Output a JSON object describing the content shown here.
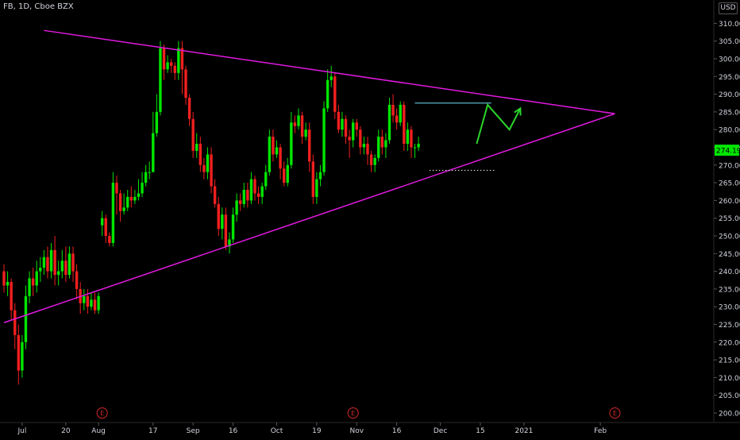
{
  "header": {
    "symbol": "FB, 1D, Cboe BZX",
    "currency": "USD"
  },
  "price_tag": "274.19",
  "colors": {
    "up": "#00e600",
    "down": "#f0201e",
    "trendline": "#e01adf",
    "projection": "#2bd52b",
    "resistance": "#5bb6c9",
    "support": "#cfcfcf",
    "axis_text": "#d1d4dc",
    "earnings": "#d12929",
    "price_tag_bg": "#00e600"
  },
  "chart_data": {
    "type": "candlestick",
    "y_axis": {
      "min": 197.5,
      "max": 317.5,
      "ticks": [
        "200.00",
        "205.00",
        "210.00",
        "215.00",
        "220.00",
        "225.00",
        "230.00",
        "235.00",
        "240.00",
        "245.00",
        "250.00",
        "255.00",
        "260.00",
        "265.00",
        "270.00",
        "275.00",
        "280.00",
        "285.00",
        "290.00",
        "295.00",
        "300.00",
        "305.00",
        "310.00"
      ]
    },
    "x_axis": {
      "labels": [
        {
          "label": "Jul",
          "session": 5
        },
        {
          "label": "20",
          "session": 17
        },
        {
          "label": "Aug",
          "session": 26
        },
        {
          "label": "17",
          "session": 41
        },
        {
          "label": "Sep",
          "session": 52
        },
        {
          "label": "16",
          "session": 63
        },
        {
          "label": "Oct",
          "session": 75
        },
        {
          "label": "19",
          "session": 86
        },
        {
          "label": "Nov",
          "session": 97
        },
        {
          "label": "16",
          "session": 108
        },
        {
          "label": "Dec",
          "session": 120
        },
        {
          "label": "15",
          "session": 131
        },
        {
          "label": "2021",
          "session": 143
        },
        {
          "label": "Feb",
          "session": 164
        }
      ]
    },
    "earnings_markers": [
      {
        "label": "E",
        "session": 27
      },
      {
        "label": "E",
        "session": 96
      },
      {
        "label": "E",
        "session": 168
      }
    ],
    "candles": [
      [
        240,
        236,
        242,
        234
      ],
      [
        236,
        237,
        240,
        233
      ],
      [
        237,
        229,
        238,
        226
      ],
      [
        229,
        222,
        231,
        218
      ],
      [
        222,
        212,
        225,
        208
      ],
      [
        212,
        220,
        222,
        210
      ],
      [
        220,
        233,
        236,
        218
      ],
      [
        233,
        238,
        240,
        231
      ],
      [
        238,
        236,
        241,
        233
      ],
      [
        236,
        240,
        243,
        234
      ],
      [
        240,
        241,
        244,
        237
      ],
      [
        241,
        244,
        246,
        239
      ],
      [
        244,
        240,
        247,
        238
      ],
      [
        240,
        246,
        248,
        238
      ],
      [
        246,
        239,
        250,
        236
      ],
      [
        239,
        240,
        243,
        236
      ],
      [
        240,
        243,
        246,
        238
      ],
      [
        243,
        239,
        247,
        237
      ],
      [
        239,
        245,
        247,
        238
      ],
      [
        245,
        240,
        247,
        237
      ],
      [
        240,
        235,
        242,
        232
      ],
      [
        235,
        231,
        237,
        228
      ],
      [
        231,
        233,
        235,
        229
      ],
      [
        233,
        230,
        235,
        228
      ],
      [
        230,
        232,
        234,
        229
      ],
      [
        232,
        229,
        234,
        228
      ],
      [
        229,
        233,
        234,
        228
      ],
      [
        253,
        255,
        257,
        250
      ],
      [
        255,
        250,
        256,
        248
      ],
      [
        250,
        248,
        251,
        247
      ],
      [
        248,
        265,
        268,
        247
      ],
      [
        265,
        262,
        267,
        256
      ],
      [
        262,
        257,
        263,
        254
      ],
      [
        257,
        258,
        262,
        256
      ],
      [
        258,
        261,
        263,
        257
      ],
      [
        261,
        260,
        264,
        258
      ],
      [
        260,
        261,
        263,
        259
      ],
      [
        261,
        262,
        266,
        260
      ],
      [
        262,
        265,
        268,
        261
      ],
      [
        265,
        268,
        270,
        264
      ],
      [
        268,
        268,
        271,
        266
      ],
      [
        268,
        279,
        285,
        268
      ],
      [
        279,
        285,
        290,
        278
      ],
      [
        285,
        303,
        305,
        284
      ],
      [
        303,
        297,
        304,
        294
      ],
      [
        297,
        299,
        301,
        296
      ],
      [
        299,
        298,
        300,
        296
      ],
      [
        298,
        296,
        299,
        294
      ],
      [
        296,
        303,
        305,
        294
      ],
      [
        303,
        297,
        305,
        290
      ],
      [
        297,
        289,
        298,
        287
      ],
      [
        289,
        283,
        290,
        281
      ],
      [
        283,
        274,
        285,
        272
      ],
      [
        274,
        276,
        279,
        272
      ],
      [
        276,
        270,
        278,
        268
      ],
      [
        270,
        268,
        272,
        266
      ],
      [
        268,
        273,
        275,
        266
      ],
      [
        273,
        264,
        275,
        262
      ],
      [
        264,
        259,
        266,
        258
      ],
      [
        259,
        252,
        261,
        250
      ],
      [
        252,
        256,
        258,
        249
      ],
      [
        256,
        247,
        258,
        246
      ],
      [
        247,
        249,
        251,
        245
      ],
      [
        249,
        256,
        258,
        248
      ],
      [
        256,
        260,
        262,
        254
      ],
      [
        260,
        259,
        262,
        257
      ],
      [
        259,
        263,
        265,
        258
      ],
      [
        263,
        260,
        265,
        258
      ],
      [
        260,
        266,
        268,
        259
      ],
      [
        266,
        262,
        267,
        260
      ],
      [
        262,
        261,
        264,
        259
      ],
      [
        261,
        264,
        265,
        259
      ],
      [
        264,
        268,
        270,
        263
      ],
      [
        268,
        278,
        280,
        267
      ],
      [
        278,
        273,
        280,
        271
      ],
      [
        273,
        275,
        277,
        272
      ],
      [
        275,
        269,
        276,
        266
      ],
      [
        269,
        265,
        271,
        264
      ],
      [
        265,
        270,
        272,
        264
      ],
      [
        270,
        282,
        285,
        269
      ],
      [
        282,
        281,
        284,
        279
      ],
      [
        281,
        284,
        286,
        280
      ],
      [
        284,
        278,
        285,
        276
      ],
      [
        278,
        280,
        282,
        277
      ],
      [
        280,
        271,
        282,
        268
      ],
      [
        271,
        261,
        273,
        259
      ],
      [
        261,
        266,
        268,
        259
      ],
      [
        266,
        268,
        270,
        264
      ],
      [
        268,
        286,
        288,
        267
      ],
      [
        286,
        294,
        297,
        285
      ],
      [
        294,
        295,
        298,
        292
      ],
      [
        295,
        285,
        296,
        283
      ],
      [
        285,
        280,
        287,
        279
      ],
      [
        280,
        283,
        285,
        278
      ],
      [
        283,
        278,
        284,
        276
      ],
      [
        278,
        277,
        280,
        272
      ],
      [
        277,
        282,
        283,
        275
      ],
      [
        282,
        280,
        283,
        278
      ],
      [
        280,
        275,
        281,
        273
      ],
      [
        275,
        276,
        278,
        273
      ],
      [
        276,
        273,
        278,
        270
      ],
      [
        273,
        270,
        274,
        268
      ],
      [
        270,
        272,
        273,
        268
      ],
      [
        272,
        278,
        280,
        271
      ],
      [
        278,
        275,
        280,
        273
      ],
      [
        275,
        277,
        279,
        272
      ],
      [
        277,
        287,
        289,
        276
      ],
      [
        287,
        284,
        290,
        282
      ],
      [
        284,
        282,
        286,
        280
      ],
      [
        282,
        287,
        288,
        281
      ],
      [
        287,
        276,
        288,
        274
      ],
      [
        276,
        280,
        282,
        274
      ],
      [
        280,
        275,
        281,
        272
      ],
      [
        275,
        275,
        276,
        272
      ],
      [
        275,
        276,
        278,
        274
      ]
    ],
    "price_tag_value": 274.19,
    "drawings": {
      "upper_trendline": {
        "from": [
          11,
          308
        ],
        "to": [
          168,
          284.5
        ]
      },
      "lower_trendline": {
        "from": [
          0,
          225.5
        ],
        "to": [
          168,
          284.5
        ]
      },
      "resistance_line": {
        "from": [
          113,
          287.5
        ],
        "to": [
          134,
          287.5
        ]
      },
      "support_dotted": {
        "from": [
          117,
          268.5
        ],
        "to": [
          135,
          268.5
        ]
      },
      "projection_path": [
        [
          130,
          276
        ],
        [
          133,
          287
        ],
        [
          139,
          280
        ],
        [
          142,
          286
        ]
      ]
    }
  }
}
